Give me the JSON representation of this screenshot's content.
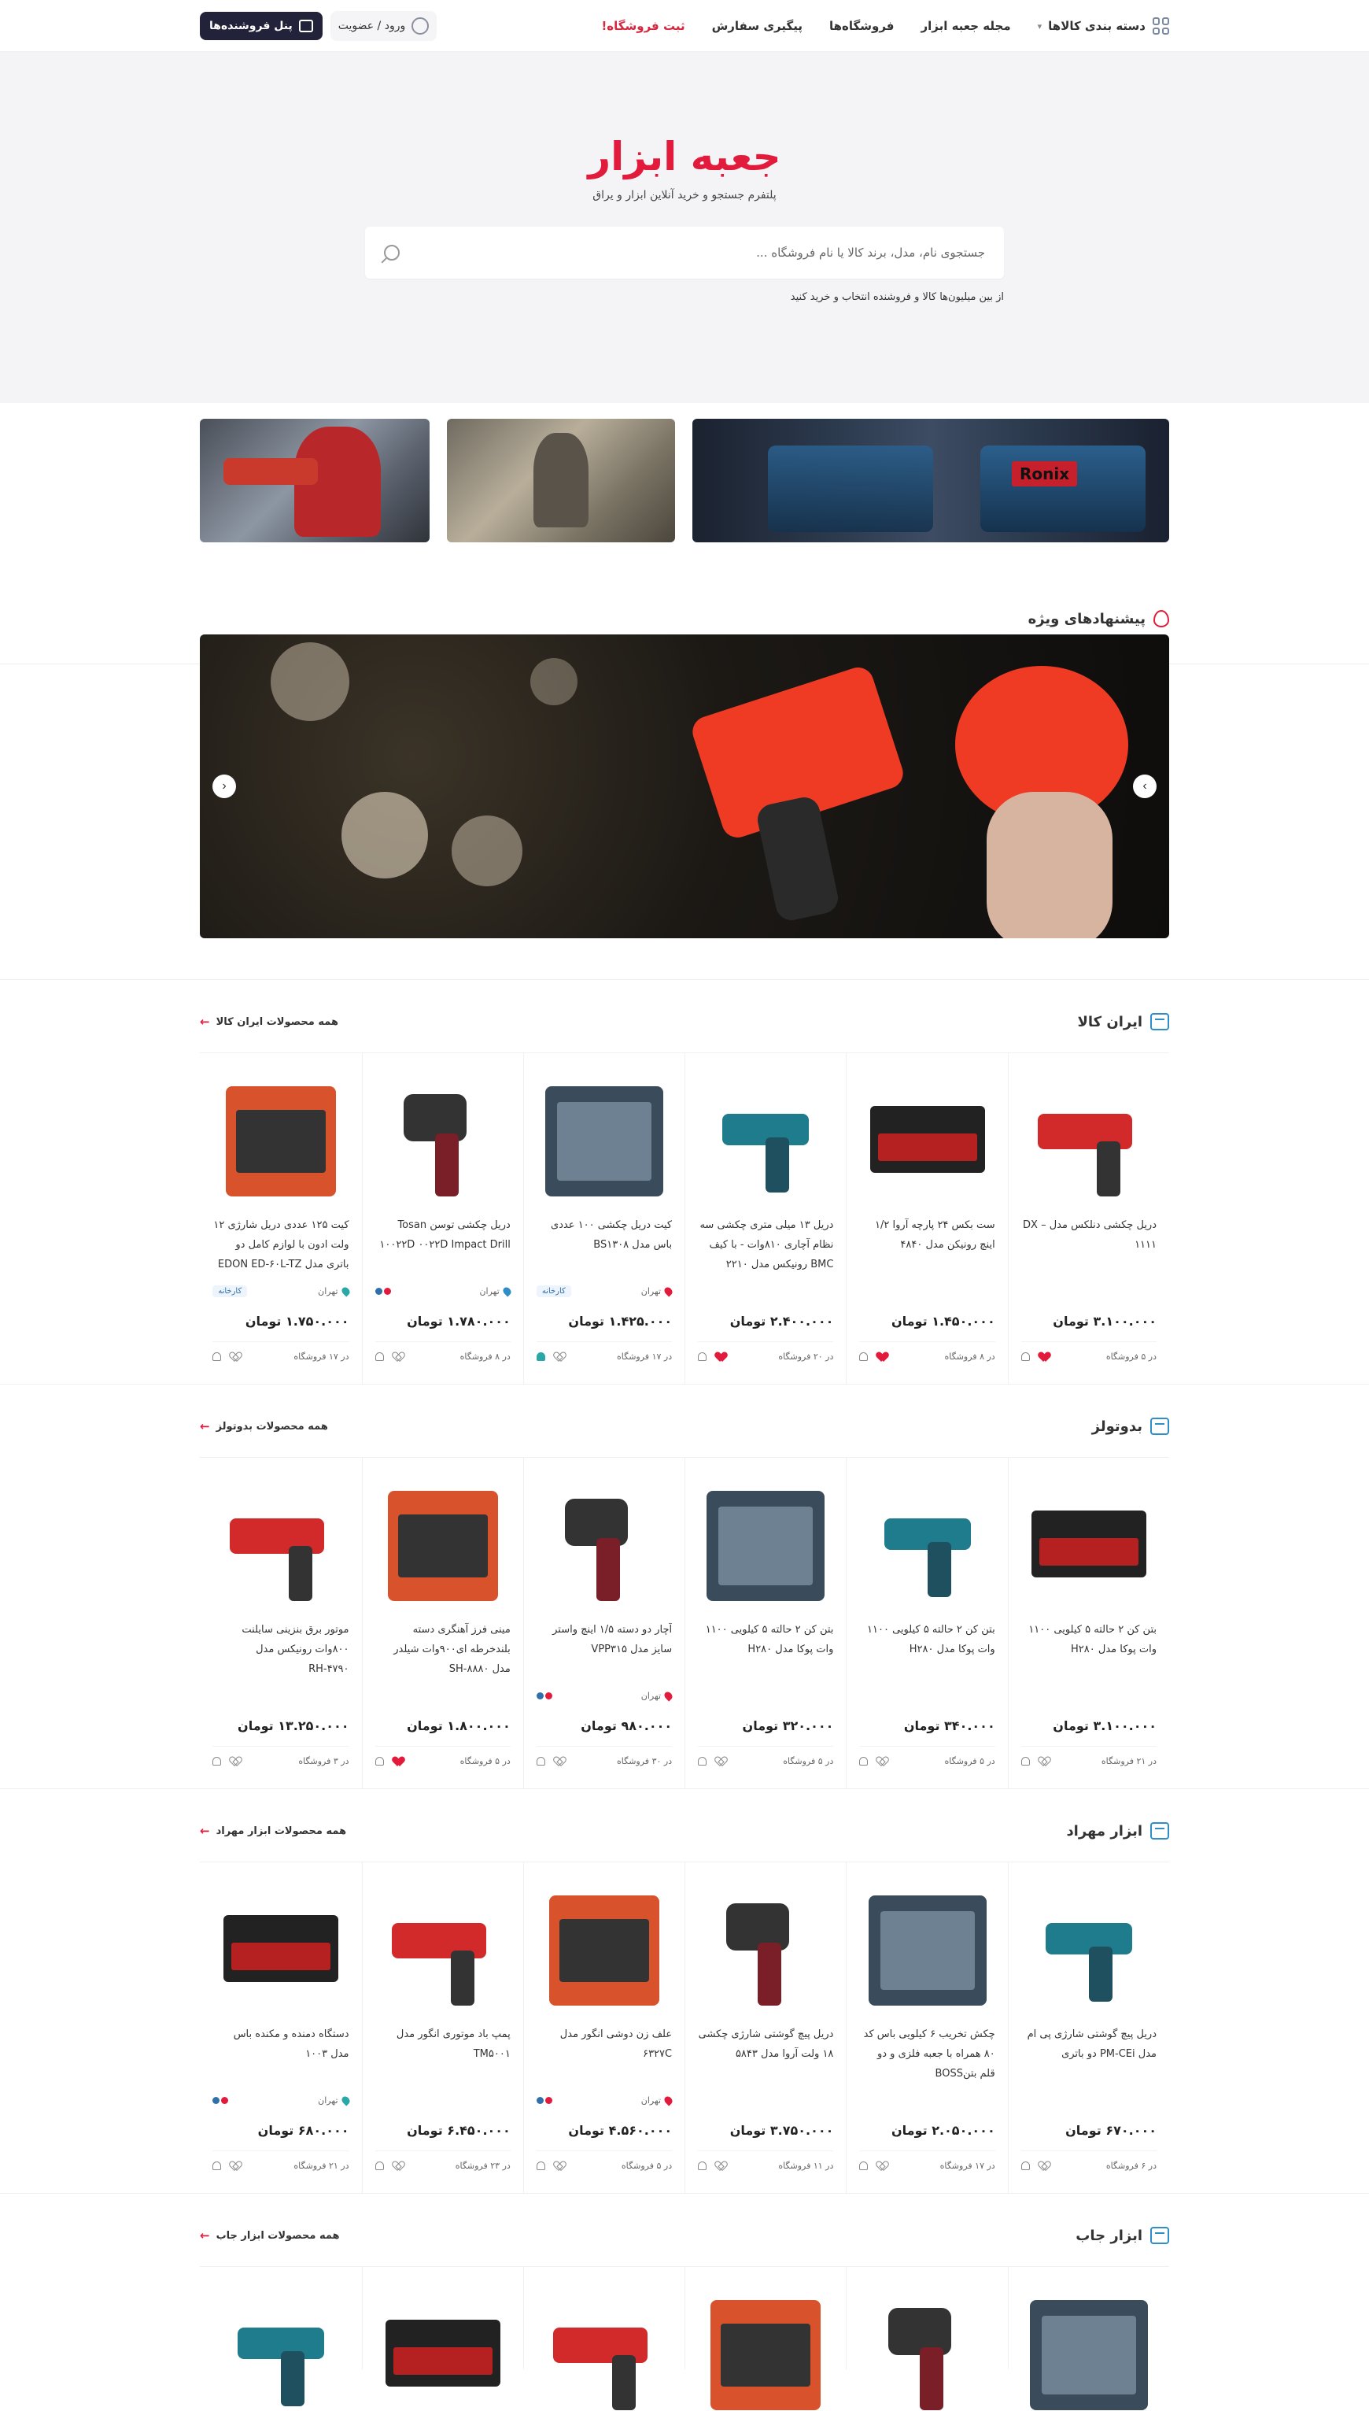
{
  "header": {
    "nav": {
      "categories": "دسته بندی کالاها",
      "magazine": "مجله جعبه ابزار",
      "stores": "فروشگاه‌ها",
      "tracking": "پیگیری سفارش",
      "register_store": "ثبت فروشگاه!"
    },
    "login": "ورود / عضویت",
    "seller_panel": "پنل فروشنده‌ها"
  },
  "hero": {
    "logo": "جعبه ابزار",
    "tagline": "پلتفرم جستجو و خرید آنلاین ابزار و یراق",
    "search_placeholder": "جستجوی نام، مدل، برند کالا یا نام فروشگاه ...",
    "hint": "از بین میلیون‌ها کالا و فروشنده انتخاب و خرید کنید"
  },
  "banners": {
    "ronix_label": "Ronix"
  },
  "special": {
    "title": "پیشنهادهای ویژه"
  },
  "colors": {
    "brand_red": "#e21b3c",
    "dark_button": "#22223a",
    "store_icon": "#2f8ec7"
  },
  "stores": [
    {
      "name": "ایران کالا",
      "all_link": "همه محصولات ایران کالا",
      "products": [
        {
          "title": "دریل چکشی دنلکس مدل DX – ۱۱۱۱",
          "city": "",
          "badge": "",
          "price": "۳.۱۰۰.۰۰۰ تومان",
          "stores": "در ۵ فروشگاه",
          "liked": true,
          "notify": false
        },
        {
          "title": "ست بکس ۲۴ پارچه آروا ۱/۲ اینچ رونیکن مدل ۴۸۴۰",
          "city": "",
          "badge": "",
          "price": "۱.۴۵۰.۰۰۰ تومان",
          "stores": "در ۸ فروشگاه",
          "liked": true,
          "notify": false
        },
        {
          "title": "دریل ۱۳ میلی متری چکشی سه نظام آچاری ۸۱۰وات - با کیف BMC رونیکس مدل ۲۲۱۰",
          "city": "",
          "badge": "",
          "price": "۲.۴۰۰.۰۰۰ تومان",
          "stores": "در ۲۰ فروشگاه",
          "liked": true,
          "notify": false
        },
        {
          "title": "کیت دریل چکشی ۱۰۰ عددی باس مدل BS۱۳۰۸",
          "city": "تهران",
          "badge": "کارخانه",
          "price": "۱.۴۲۵.۰۰۰ تومان",
          "stores": "در ۱۷ فروشگاه",
          "liked": false,
          "notify": true
        },
        {
          "title": "دریل چکشی توسن Tosan ۱۰۰۲۲D ۰۰۲۲D Impact Drill",
          "city": "تهران",
          "badge": "",
          "price": "۱.۷۸۰.۰۰۰ تومان",
          "stores": "در ۸ فروشگاه",
          "liked": false,
          "notify": false
        },
        {
          "title": "کیت ۱۲۵ عددی دریل شارژی ۱۲ ولت ادون با لوازم کامل دو باتری مدل EDON ED-۶۰L-TZ",
          "city": "تهران",
          "badge": "کارخانه",
          "price": "۱.۷۵۰.۰۰۰ تومان",
          "stores": "در ۱۷ فروشگاه",
          "liked": false,
          "notify": false
        }
      ]
    },
    {
      "name": "بدوتولز",
      "all_link": "همه محصولات بدوتولز",
      "products": [
        {
          "title": "بتن کن ۲ حالته ۵ کیلویی ۱۱۰۰ وات پوکا مدل H۲۸۰",
          "city": "",
          "badge": "",
          "price": "۳.۱۰۰.۰۰۰ تومان",
          "stores": "در ۲۱ فروشگاه",
          "liked": false,
          "notify": false
        },
        {
          "title": "بتن کن ۲ حالته ۵ کیلویی ۱۱۰۰ وات پوکا مدل H۲۸۰",
          "city": "",
          "badge": "",
          "price": "۳۴۰.۰۰۰ تومان",
          "stores": "در ۵ فروشگاه",
          "liked": false,
          "notify": false
        },
        {
          "title": "بتن کن ۲ حالته ۵ کیلویی ۱۱۰۰ وات پوکا مدل H۲۸۰",
          "city": "",
          "badge": "",
          "price": "۳۲۰.۰۰۰ تومان",
          "stores": "در ۵ فروشگاه",
          "liked": false,
          "notify": false
        },
        {
          "title": "آچار دو دسته ۱/۵ اینچ واستر سایز مدل VPP۳۱۵",
          "city": "تهران",
          "badge": "",
          "price": "۹۸۰.۰۰۰ تومان",
          "stores": "در ۳۰ فروشگاه",
          "liked": false,
          "notify": false
        },
        {
          "title": "مینی فرز آهنگری دسته بلندخرطه ای۹۰۰وات شیلدر مدل SH-۸۸۸۰",
          "city": "",
          "badge": "",
          "price": "۱.۸۰۰.۰۰۰ تومان",
          "stores": "در ۵ فروشگاه",
          "liked": true,
          "notify": false
        },
        {
          "title": "موتور برق بنزینی سایلنت ۸۰۰وات رونیکس مدل RH-۴۷۹۰",
          "city": "",
          "badge": "",
          "price": "۱۳.۲۵۰.۰۰۰ تومان",
          "stores": "در ۳ فروشگاه",
          "liked": false,
          "notify": false
        }
      ]
    },
    {
      "name": "ابزار مهراد",
      "all_link": "همه محصولات ابزار مهراد",
      "products": [
        {
          "title": "دریل پیچ گوشتی شارژی پی ام مدل PM-CEi دو باتری",
          "city": "",
          "badge": "",
          "price": "۶۷۰.۰۰۰ تومان",
          "stores": "در ۶ فروشگاه",
          "liked": false,
          "notify": false
        },
        {
          "title": "چکش تخریب ۶ کیلویی باس کد ۸۰ همراه با جعبه فلزی و دو قلم بتنBOSS",
          "city": "",
          "badge": "",
          "price": "۲.۰۵۰.۰۰۰ تومان",
          "stores": "در ۱۷ فروشگاه",
          "liked": false,
          "notify": false
        },
        {
          "title": "دریل پیچ گوشتی شارژی چکشی ۱۸ ولت آروا مدل ۵۸۴۳",
          "city": "",
          "badge": "",
          "price": "۳.۷۵۰.۰۰۰ تومان",
          "stores": "در ۱۱ فروشگاه",
          "liked": false,
          "notify": false
        },
        {
          "title": "علف زن دوشی انگور مدل ۶۳۲۷C",
          "city": "تهران",
          "badge": "",
          "price": "۴.۵۶۰.۰۰۰ تومان",
          "stores": "در ۵ فروشگاه",
          "liked": false,
          "notify": false
        },
        {
          "title": "پمپ باد موتوری انگور مدل TM۵۰۰۱",
          "city": "",
          "badge": "",
          "price": "۶.۴۵۰.۰۰۰ تومان",
          "stores": "در ۲۳ فروشگاه",
          "liked": false,
          "notify": false
        },
        {
          "title": "دستگاه دمنده و مکنده باس مدل ۱۰۰۳",
          "city": "تهران",
          "badge": "",
          "price": "۶۸۰.۰۰۰ تومان",
          "stores": "در ۲۱ فروشگاه",
          "liked": false,
          "notify": false
        }
      ]
    },
    {
      "name": "ابزار جاب",
      "all_link": "همه محصولات ابزار جاب",
      "products": []
    }
  ]
}
